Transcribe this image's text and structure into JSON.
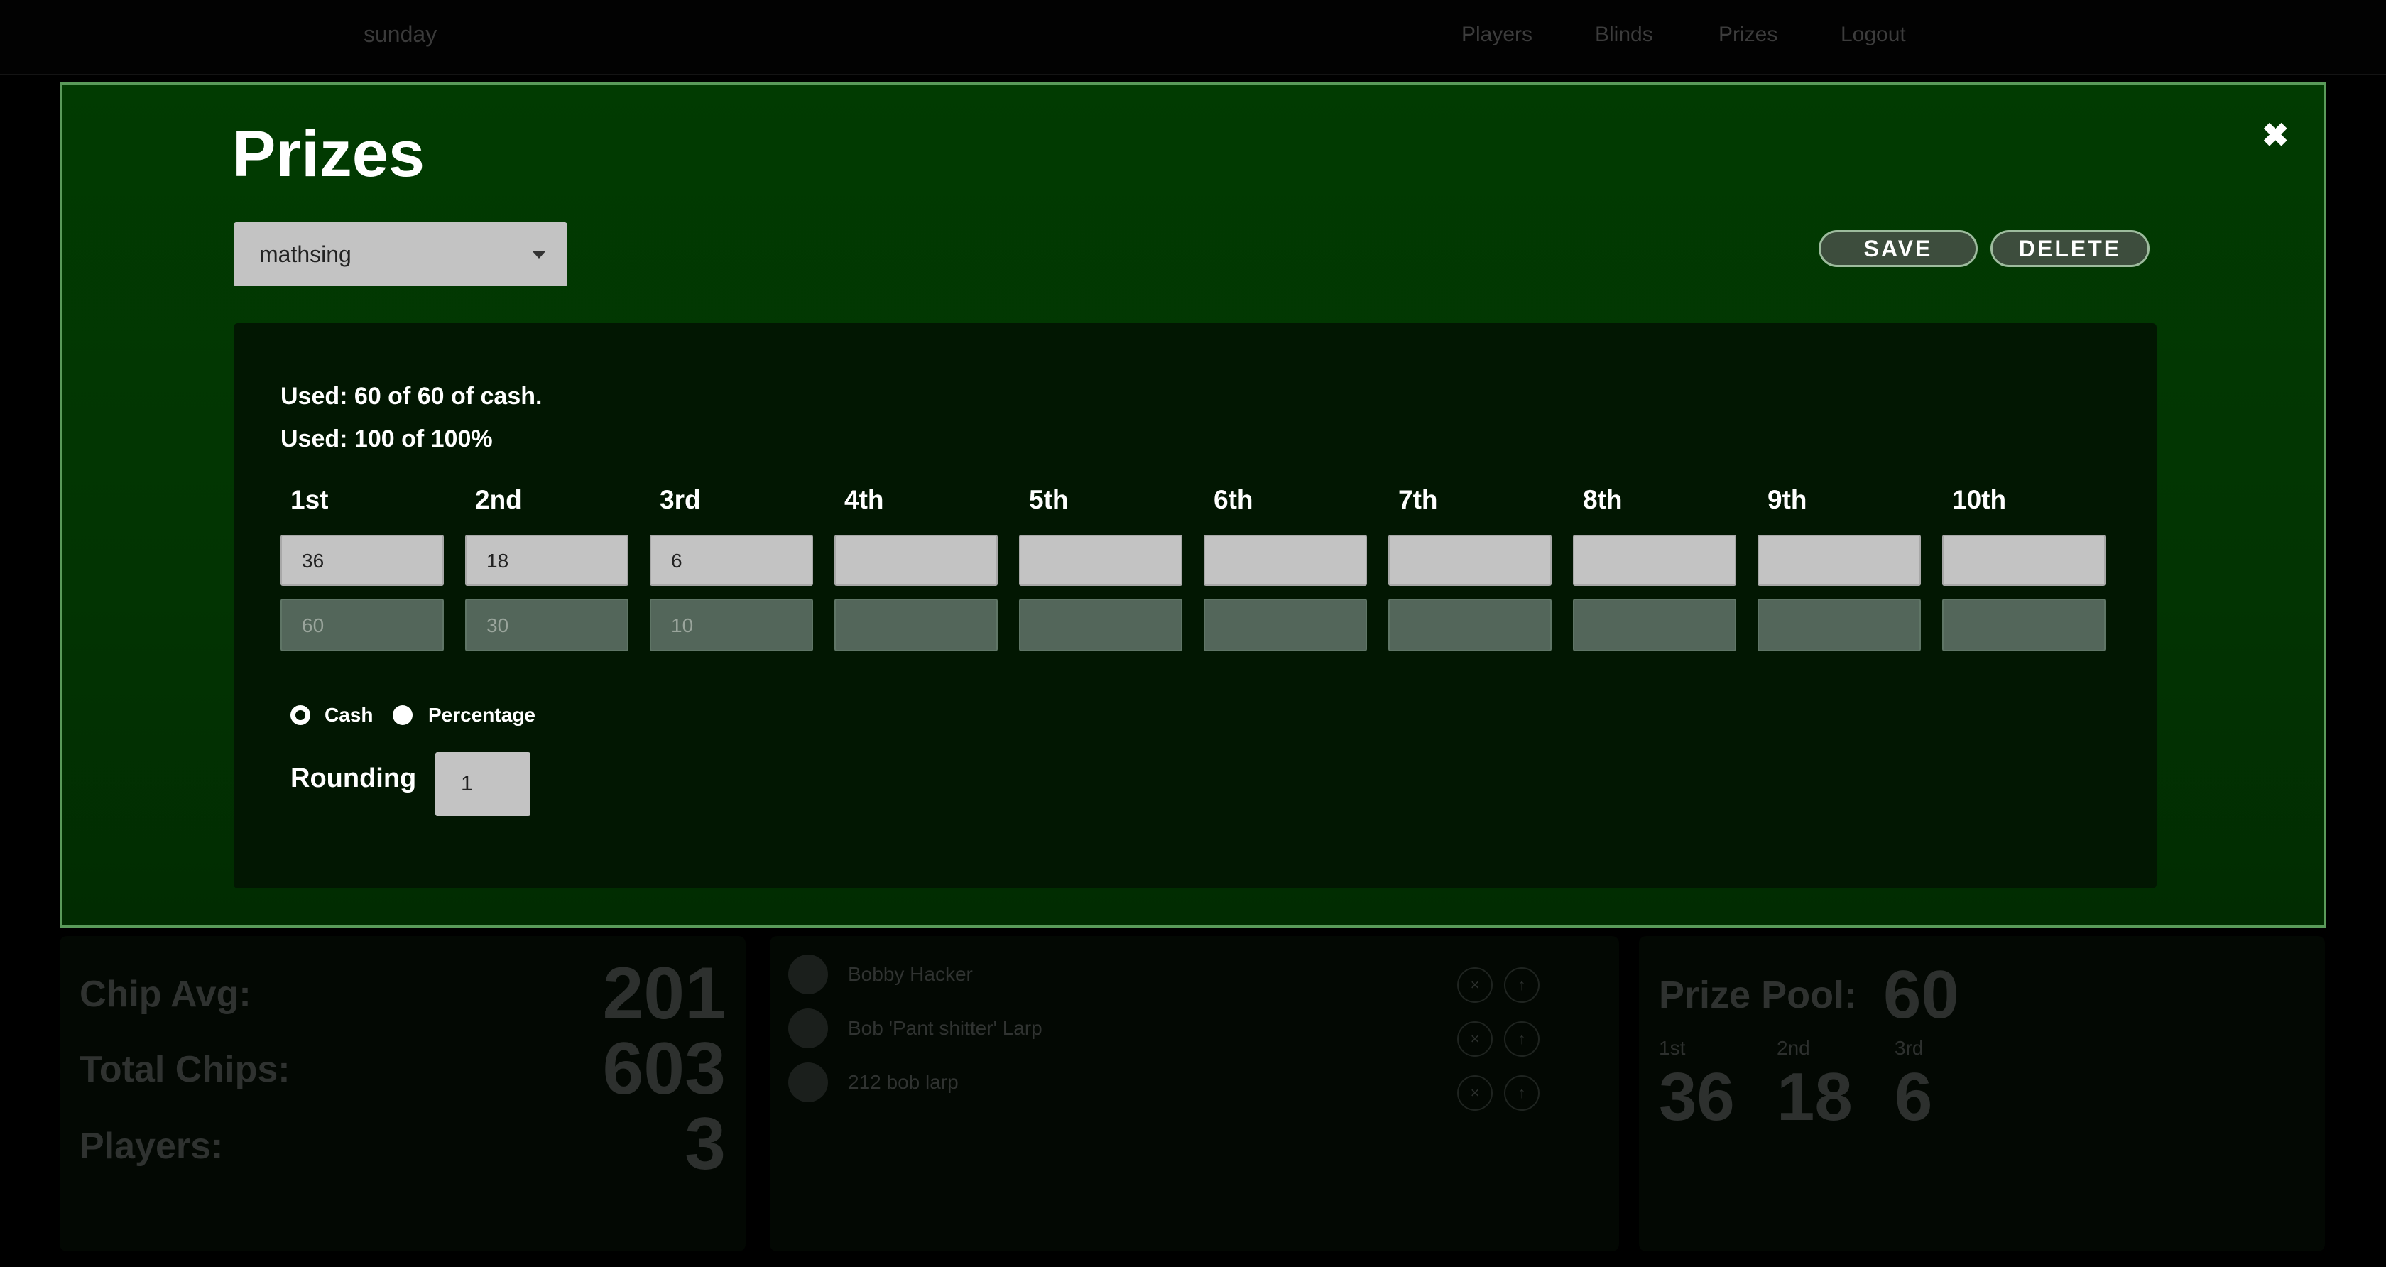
{
  "nav": {
    "brand": "sunday",
    "links": [
      "Players",
      "Blinds",
      "Prizes",
      "Logout"
    ]
  },
  "stats": {
    "chip_avg_label": "Chip Avg:",
    "chip_avg_value": "201",
    "total_chips_label": "Total Chips:",
    "total_chips_value": "603",
    "players_label": "Players:",
    "players_value": "3"
  },
  "players": [
    {
      "name": "Bobby Hacker"
    },
    {
      "name": "Bob 'Pant shitter' Larp"
    },
    {
      "name": "212 bob larp"
    }
  ],
  "player_actions": {
    "remove_icon": "×",
    "rebuy_icon": "↑"
  },
  "prize_pool": {
    "label": "Prize Pool:",
    "value": "60",
    "places": [
      {
        "place": "1st",
        "amount": "36"
      },
      {
        "place": "2nd",
        "amount": "18"
      },
      {
        "place": "3rd",
        "amount": "6"
      }
    ]
  },
  "modal": {
    "title": "Prizes",
    "close_icon": "✖",
    "structure_select_value": "mathsing",
    "save_label": "SAVE",
    "delete_label": "DELETE",
    "used_cash": "Used: 60 of 60 of cash.",
    "used_pct": "Used: 100 of 100%",
    "places": [
      {
        "label": "1st",
        "cash": "36",
        "pct": "60"
      },
      {
        "label": "2nd",
        "cash": "18",
        "pct": "30"
      },
      {
        "label": "3rd",
        "cash": "6",
        "pct": "10"
      },
      {
        "label": "4th",
        "cash": "",
        "pct": ""
      },
      {
        "label": "5th",
        "cash": "",
        "pct": ""
      },
      {
        "label": "6th",
        "cash": "",
        "pct": ""
      },
      {
        "label": "7th",
        "cash": "",
        "pct": ""
      },
      {
        "label": "8th",
        "cash": "",
        "pct": ""
      },
      {
        "label": "9th",
        "cash": "",
        "pct": ""
      },
      {
        "label": "10th",
        "cash": "",
        "pct": ""
      }
    ],
    "mode_options": [
      {
        "label": "Cash",
        "checked": true
      },
      {
        "label": "Percentage",
        "checked": false
      }
    ],
    "rounding_label": "Rounding",
    "rounding_value": "1"
  },
  "colors": {
    "modal_bg": "#013b01",
    "inner_bg": "#021702",
    "button_bg": "#3d4d3d"
  }
}
